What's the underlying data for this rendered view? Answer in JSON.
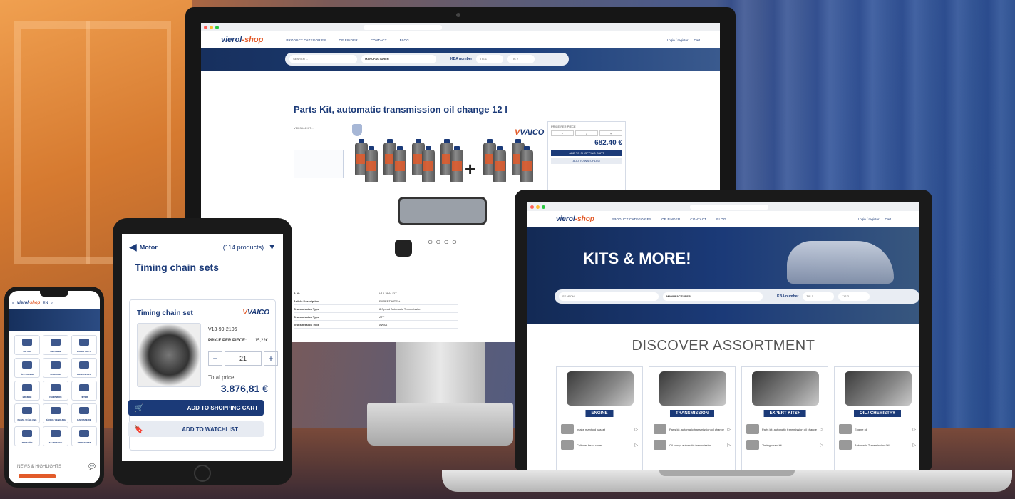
{
  "brand": {
    "name_main": "vierol",
    "name_suffix": "-shop",
    "accent": "#e25b2a",
    "primary": "#1b3a78"
  },
  "monitor": {
    "nav": [
      "PRODUCT CATEGORIES",
      "OE FINDER",
      "CONTACT",
      "BLOG"
    ],
    "header_right": [
      "Login / register",
      "Cart"
    ],
    "search": {
      "placeholder": "SEARCH ...",
      "manufacturer": "MANUFACTURER",
      "kba_label": "KBA number",
      "kba1": "TIS 1",
      "kba2": "TIS 2"
    },
    "product": {
      "title": "Parts Kit, automatic transmission oil change 12 l",
      "article_no": "V10-3844 KIT...",
      "brand": "VAICO",
      "price_per_piece_label": "PRICE PER PIECE",
      "price_total": "682.40 €",
      "add_to_cart": "ADD TO SHOPPING CART",
      "add_to_watchlist": "ADD TO WATCHLIST"
    },
    "specs": [
      {
        "k": "A-Nr.",
        "v": "V10-3844 KIT"
      },
      {
        "k": "Article Description",
        "v": "EXPERT KITS +"
      },
      {
        "k": "Transmission Type",
        "v": "8-Speed Automatic Transmission"
      },
      {
        "k": "Transmission Type",
        "v": "ATF"
      },
      {
        "k": "Transmission Type",
        "v": "AW8A"
      }
    ]
  },
  "laptop": {
    "nav": [
      "PRODUCT CATEGORIES",
      "OE FINDER",
      "CONTACT",
      "BLOG"
    ],
    "header_right": [
      "Login / register",
      "Cart"
    ],
    "hero_title": "KITS & MORE!",
    "search": {
      "placeholder": "SEARCH ...",
      "manufacturer": "MANUFACTURER",
      "kba_label": "KBA number",
      "kba1": "TIS 1",
      "kba2": "TIS 2"
    },
    "discover": "DISCOVER ASSORTMENT",
    "cards": [
      {
        "label": "ENGINE",
        "rows": [
          "Intake manifold gasket",
          "Cylinder head cover"
        ]
      },
      {
        "label": "TRANSMISSION",
        "rows": [
          "Parts kit, automatic transmission oil change",
          "Oil sump, automatic transmission"
        ]
      },
      {
        "label": "EXPERT KITS+",
        "rows": [
          "Parts kit, automatic transmission oil change",
          "Timing chain kit"
        ]
      },
      {
        "label": "OIL / CHEMISTRY",
        "rows": [
          "Engine oil",
          "Automatic Transmission Oil"
        ]
      }
    ]
  },
  "tablet": {
    "category": "Motor",
    "count": "(114 products)",
    "title": "Timing chain sets",
    "product_name": "Timing chain set",
    "brand": "VAICO",
    "article_no": "V13-99-2106",
    "price_per_piece_label": "PRICE PER PIECE:",
    "price_per_piece": "15,22€",
    "qty": "21",
    "total_label": "Total price:",
    "total": "3.876,81 €",
    "add_to_cart": "ADD TO SHOPPING CART",
    "add_to_watchlist": "ADD TO WATCHLIST"
  },
  "phone": {
    "lang": "EN",
    "tiles": [
      "MOTOR",
      "GETRIEBE",
      "EXPERT KITS",
      "ÖL / CHEMIE",
      "ELEKTRIK",
      "KRAFTSTOFF",
      "BREMSE",
      "FAHRWERK",
      "FILTER",
      "KLIMA / KÜHLUNG",
      "RÄDER / LENKUNG",
      "KAROSSERIE",
      "ZUBEHÖR",
      "FAHRZEUGE",
      "WERKSTATT"
    ],
    "news": "NEWS & HIGHLIGHTS"
  }
}
